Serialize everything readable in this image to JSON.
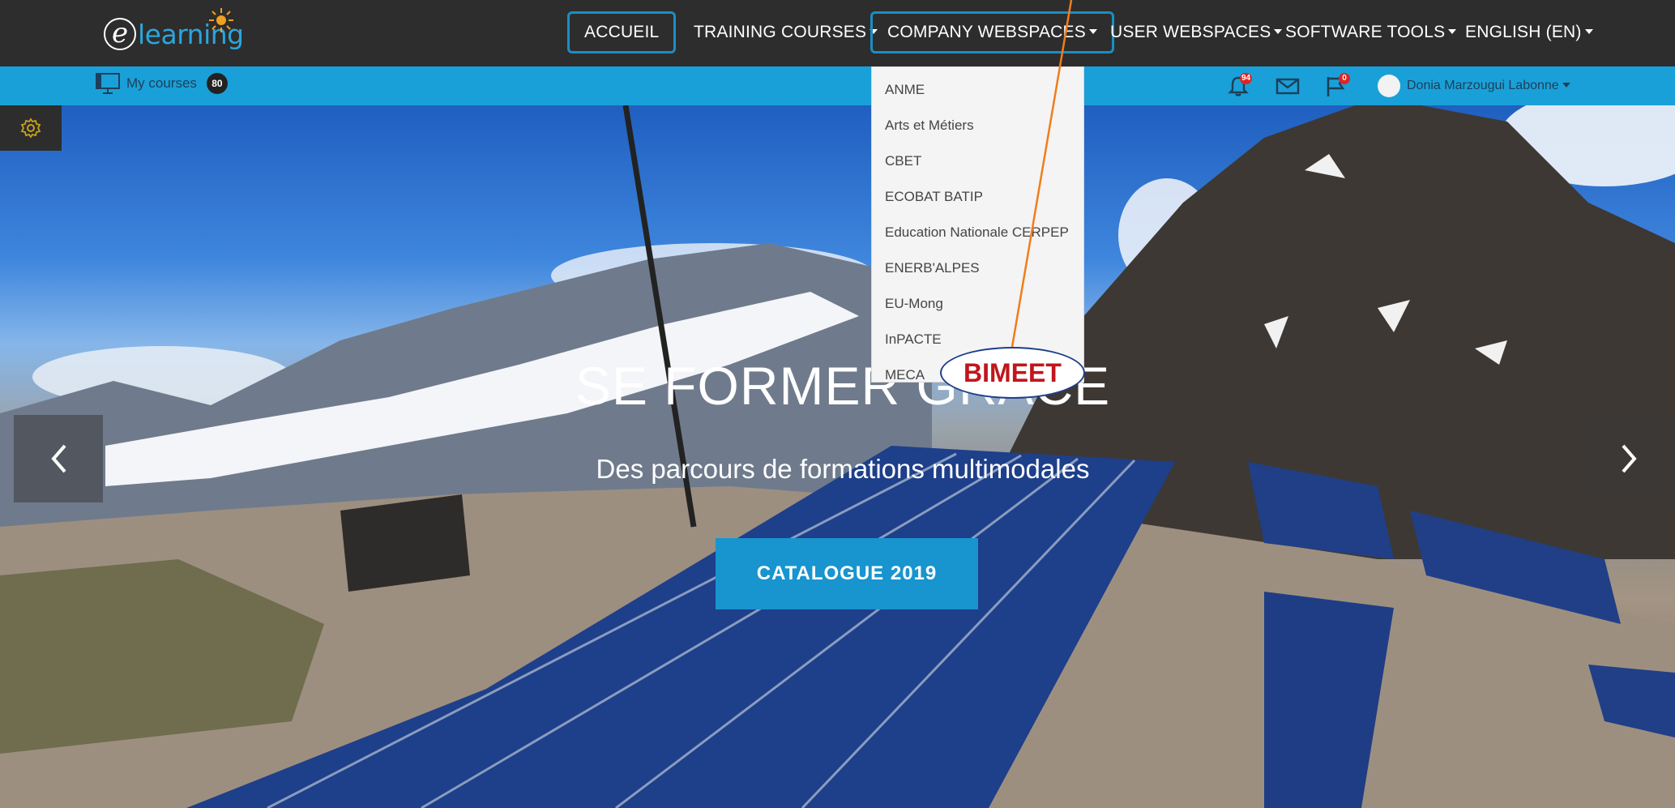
{
  "brand": {
    "logo_letter": "e",
    "logo_text": "learning"
  },
  "nav": {
    "items": [
      {
        "label": "ACCUEIL",
        "caret": false
      },
      {
        "label": "TRAINING COURSES",
        "caret": true
      },
      {
        "label": "COMPANY WEBSPACES",
        "caret": true
      },
      {
        "label": "USER WEBSPACES",
        "caret": true
      },
      {
        "label": "SOFTWARE TOOLS",
        "caret": true
      },
      {
        "label": "ENGLISH (EN)",
        "caret": true
      }
    ]
  },
  "subbar": {
    "my_courses_label": "My courses",
    "my_courses_count": "80",
    "notifications_count": "94",
    "flags_count": "0",
    "user_name": "Donia Marzougui Labonne"
  },
  "dropdown": {
    "items": [
      "ANME",
      "Arts et Métiers",
      "CBET",
      "ECOBAT BATIP",
      "Education Nationale CERPEP",
      "ENERB'ALPES",
      "EU-Mong",
      "InPACTE",
      "MECA"
    ]
  },
  "hero": {
    "title": "SE FORMER GRÂCE",
    "subtitle": "Des parcours de formations multimodales",
    "cta_label": "CATALOGUE 2019"
  },
  "annotation": {
    "label": "BIMEET"
  },
  "colors": {
    "topbar": "#2d2d2d",
    "accent": "#1aa0d8",
    "annotation_text": "#c0161c",
    "annotation_line": "#f07d1a"
  },
  "icons": [
    "monitor-icon",
    "bell-icon",
    "mail-icon",
    "flag-icon",
    "gear-icon",
    "chevron-left-icon",
    "chevron-right-icon"
  ]
}
